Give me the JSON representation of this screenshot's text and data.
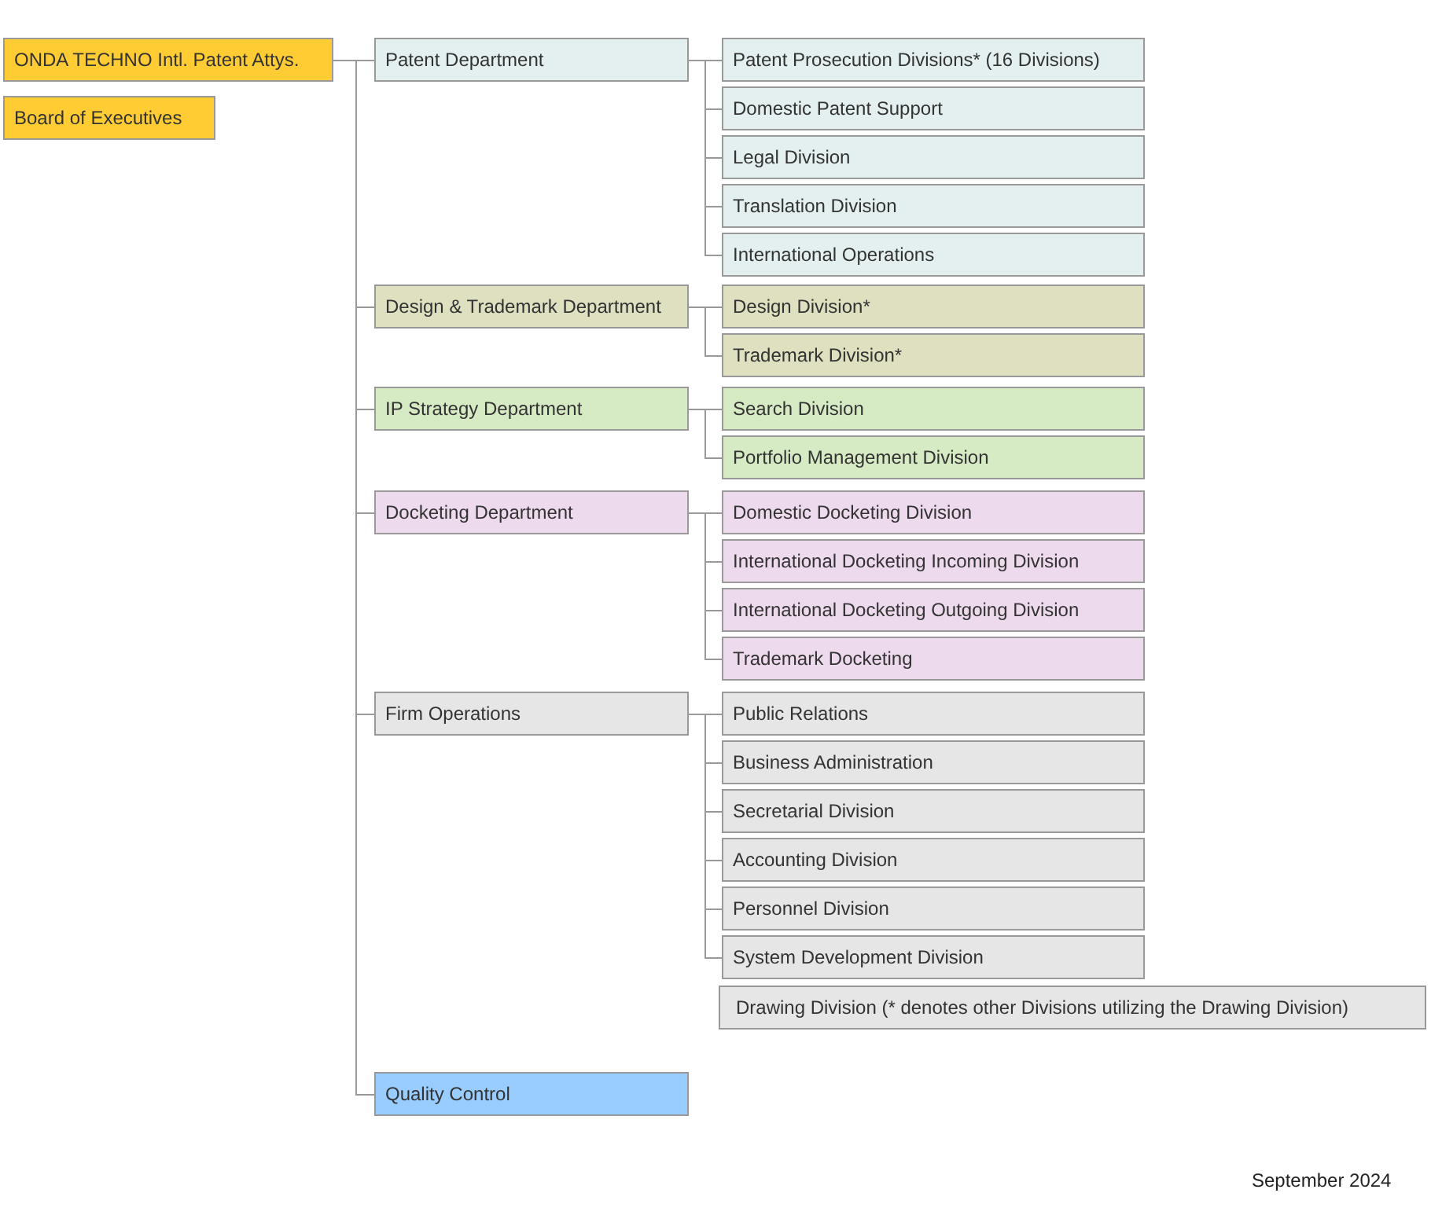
{
  "organization": {
    "name": "ONDA TECHNO Intl. Patent Attys."
  },
  "board": {
    "name": "Board of Executives"
  },
  "departments": [
    {
      "name": "Patent Department",
      "color": "#e4f0f0",
      "divisions": [
        "Patent Prosecution Divisions* (16 Divisions)",
        "Domestic Patent Support",
        "Legal Division",
        "Translation Division",
        "International Operations"
      ]
    },
    {
      "name": "Design & Trademark Department",
      "color": "#dfe0bf",
      "divisions": [
        "Design Division*",
        "Trademark Division*"
      ]
    },
    {
      "name": "IP Strategy Department",
      "color": "#d6ebc4",
      "divisions": [
        "Search Division",
        "Portfolio Management Division"
      ]
    },
    {
      "name": "Docketing Department",
      "color": "#eddbed",
      "divisions": [
        "Domestic Docketing Division",
        "International Docketing Incoming Division",
        "International Docketing Outgoing Division",
        "Trademark Docketing"
      ]
    },
    {
      "name": "Firm Operations",
      "color": "#e6e6e6",
      "divisions": [
        "Public Relations",
        "Business Administration",
        "Secretarial Division",
        "Accounting Division",
        "Personnel Division",
        "System Development Division"
      ],
      "unconnected_box": "Drawing Division (* denotes other Divisions utilizing the Drawing Division)"
    },
    {
      "name": "Quality Control",
      "color": "#99ccff"
    }
  ],
  "date": "September 2024"
}
